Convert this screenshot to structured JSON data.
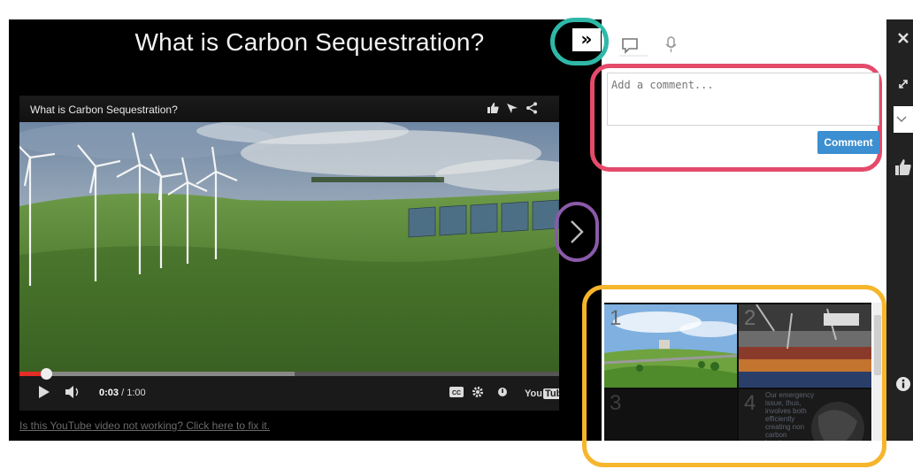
{
  "page": {
    "title": "What is Carbon Sequestration?",
    "broken_link": "Is this YouTube video not working? Click here to fix it."
  },
  "video": {
    "title": "What is Carbon Sequestration?",
    "time_current": "0:03",
    "time_total": "/ 1:00",
    "progress_played": 0.05,
    "progress_loaded": 0.51,
    "logo_text_1": "You",
    "logo_text_2": "Tube"
  },
  "collapse_button": {
    "label": "»"
  },
  "comments": {
    "placeholder": "Add a comment...",
    "submit_label": "Comment"
  },
  "slides": {
    "items": [
      {
        "number": "1"
      },
      {
        "number": "2"
      },
      {
        "number": "3"
      },
      {
        "number": "4",
        "text": "Our emergency issue, thus, involves both efficiently creating non carbon burning..."
      }
    ]
  },
  "colors": {
    "teal_highlight": "#2fb8a8",
    "pink_highlight": "#e44a6a",
    "purple_highlight": "#8b5aa8",
    "orange_highlight": "#f6b52b",
    "comment_button": "#3c8fd0",
    "youtube_red": "#e52d27"
  },
  "icons": [
    "comment-icon",
    "microphone-icon",
    "close-icon",
    "expand-icon",
    "thumbs-up-icon",
    "info-icon",
    "chevron-right-icon",
    "play-icon",
    "volume-icon",
    "cc-icon",
    "settings-icon"
  ]
}
